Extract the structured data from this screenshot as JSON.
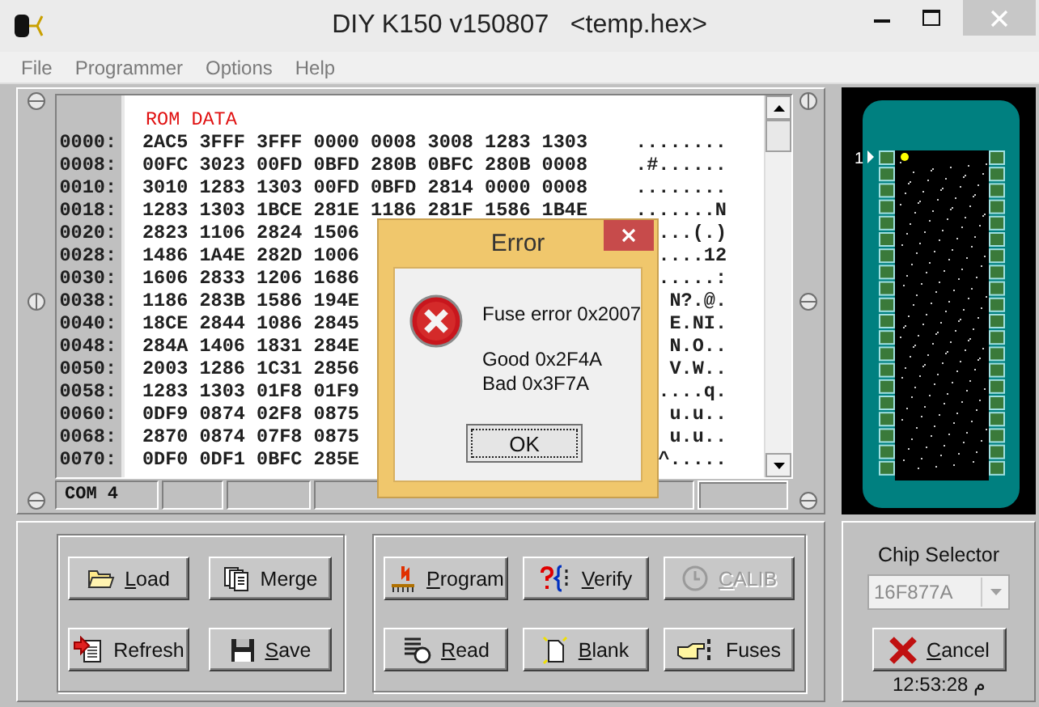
{
  "window": {
    "title": "DIY K150 v150807   <temp.hex>"
  },
  "menu": [
    "File",
    "Programmer",
    "Options",
    "Help"
  ],
  "hex_view": {
    "header": "ROM DATA",
    "rows": [
      {
        "address": "0000:",
        "hex": "2AC5 3FFF 3FFF 0000 0008 3008 1283 1303",
        "ascii": "........"
      },
      {
        "address": "0008:",
        "hex": "00FC 3023 00FD 0BFD 280B 0BFC 280B 0008",
        "ascii": ".#......"
      },
      {
        "address": "0010:",
        "hex": "3010 1283 1303 00FD 0BFD 2814 0000 0008",
        "ascii": "........"
      },
      {
        "address": "0018:",
        "hex": "1283 1303 1BCE 281E 1186 281F 1586 1B4E",
        "ascii": ".......N"
      },
      {
        "address": "0020:",
        "hex": "2823 1106 2824 1506",
        "ascii": "...(.)"
      },
      {
        "address": "0028:",
        "hex": "1486 1A4E 282D 1006",
        "ascii": "....12"
      },
      {
        "address": "0030:",
        "hex": "1606 2833 1206 1686",
        "ascii": ".....:"
      },
      {
        "address": "0038:",
        "hex": "1186 283B 1586 194E",
        "ascii": "N?.@."
      },
      {
        "address": "0040:",
        "hex": "18CE 2844 1086 2845",
        "ascii": "E.NI."
      },
      {
        "address": "0048:",
        "hex": "284A 1406 1831 284E",
        "ascii": "N.O.."
      },
      {
        "address": "0050:",
        "hex": "2003 1286 1C31 2856",
        "ascii": "V.W.."
      },
      {
        "address": "0058:",
        "hex": "1283 1303 01F8 01F9",
        "ascii": "....q."
      },
      {
        "address": "0060:",
        "hex": "0DF9 0874 02F8 0875",
        "ascii": "u.u.."
      },
      {
        "address": "0068:",
        "hex": "2870 0874 07F8 0875",
        "ascii": "u.u.."
      },
      {
        "address": "0070:",
        "hex": "0DF0 0DF1 0BFC 285E",
        "ascii": "^....."
      }
    ]
  },
  "status_bar": {
    "port": "COM 4"
  },
  "dialog": {
    "title": "Error",
    "message": "Fuse error 0x2007",
    "details": [
      "Good 0x2F4A",
      "Bad 0x3F7A"
    ],
    "button": "OK"
  },
  "file_buttons": [
    {
      "label": "Load",
      "mnemonic": true,
      "disabled": false
    },
    {
      "label": "Merge",
      "mnemonic": false,
      "disabled": false
    },
    {
      "label": "Refresh",
      "mnemonic": false,
      "disabled": false
    },
    {
      "label": "Save",
      "mnemonic": true,
      "disabled": false
    }
  ],
  "device_buttons": [
    {
      "label": "Program",
      "mnemonic": true,
      "disabled": false
    },
    {
      "label": "Verify",
      "mnemonic": true,
      "disabled": false
    },
    {
      "label": "CALIB",
      "mnemonic": true,
      "disabled": true
    },
    {
      "label": "Read",
      "mnemonic": true,
      "disabled": false
    },
    {
      "label": "Blank",
      "mnemonic": true,
      "disabled": false
    },
    {
      "label": "Fuses",
      "mnemonic": false,
      "disabled": false
    }
  ],
  "chip_selector": {
    "title": "Chip Selector",
    "value": "16F877A",
    "disabled": true,
    "cancel": {
      "label": "Cancel",
      "mnemonic": true
    },
    "time": "12:53:28 م"
  },
  "chip": {
    "pin1_label": "1"
  }
}
